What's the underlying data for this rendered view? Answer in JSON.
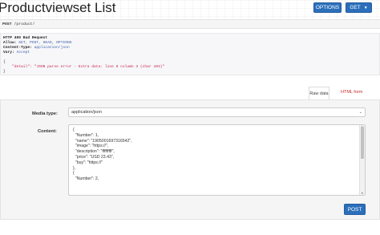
{
  "page": {
    "title": "Productviewset List"
  },
  "toolbar": {
    "options_label": "OPTIONS",
    "get_label": "GET"
  },
  "request": {
    "method": "POST",
    "path": "/product/"
  },
  "response": {
    "status_line": "HTTP 400 Bad Request",
    "headers": [
      {
        "name": "Allow:",
        "value": "GET, POST, HEAD, OPTIONS"
      },
      {
        "name": "Content-Type:",
        "value": "application/json"
      },
      {
        "name": "Vary:",
        "value": "Accept"
      }
    ],
    "body_open": "{",
    "body_detail": "    \"detail\": \"JSON parse error - Extra data: line 8 column 3 (char 103)\"",
    "body_close": "}"
  },
  "form_tabs": {
    "raw": "Raw data",
    "html": "HTML form"
  },
  "form": {
    "media_label": "Media type:",
    "media_value": "application/json",
    "content_label": "Content:",
    "content_value": "{\n  \"Number\": 1,\n  \"name\": \"1905001697316542\",\n  \"image\": \"https://\",\n  \"description\": \"fffffffff\",\n  \"price\": \"USD 23.43\",\n  \"buy\": \"https://\"\n},\n{\n  \"Number\": 2,",
    "submit_label": "POST"
  }
}
